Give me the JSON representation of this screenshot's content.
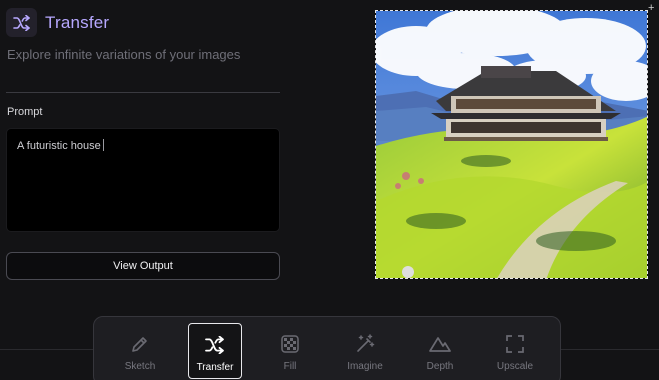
{
  "header": {
    "title": "Transfer",
    "icon": "shuffle-icon",
    "subtitle": "Explore infinite variations of your images"
  },
  "prompt": {
    "label": "Prompt",
    "value": "A futuristic house"
  },
  "view_button": {
    "label": "View Output"
  },
  "toolbar": {
    "items": [
      {
        "label": "Sketch",
        "icon": "pencil-icon",
        "active": false
      },
      {
        "label": "Transfer",
        "icon": "shuffle-icon",
        "active": true
      },
      {
        "label": "Fill",
        "icon": "checkerboard-icon",
        "active": false
      },
      {
        "label": "Imagine",
        "icon": "magic-wand-icon",
        "active": false
      },
      {
        "label": "Depth",
        "icon": "mountain-icon",
        "active": false
      },
      {
        "label": "Upscale",
        "icon": "expand-corners-icon",
        "active": false
      }
    ]
  },
  "colors": {
    "accent": "#b7a8ff",
    "background": "#131315",
    "toolbar": "#1e1e22"
  }
}
